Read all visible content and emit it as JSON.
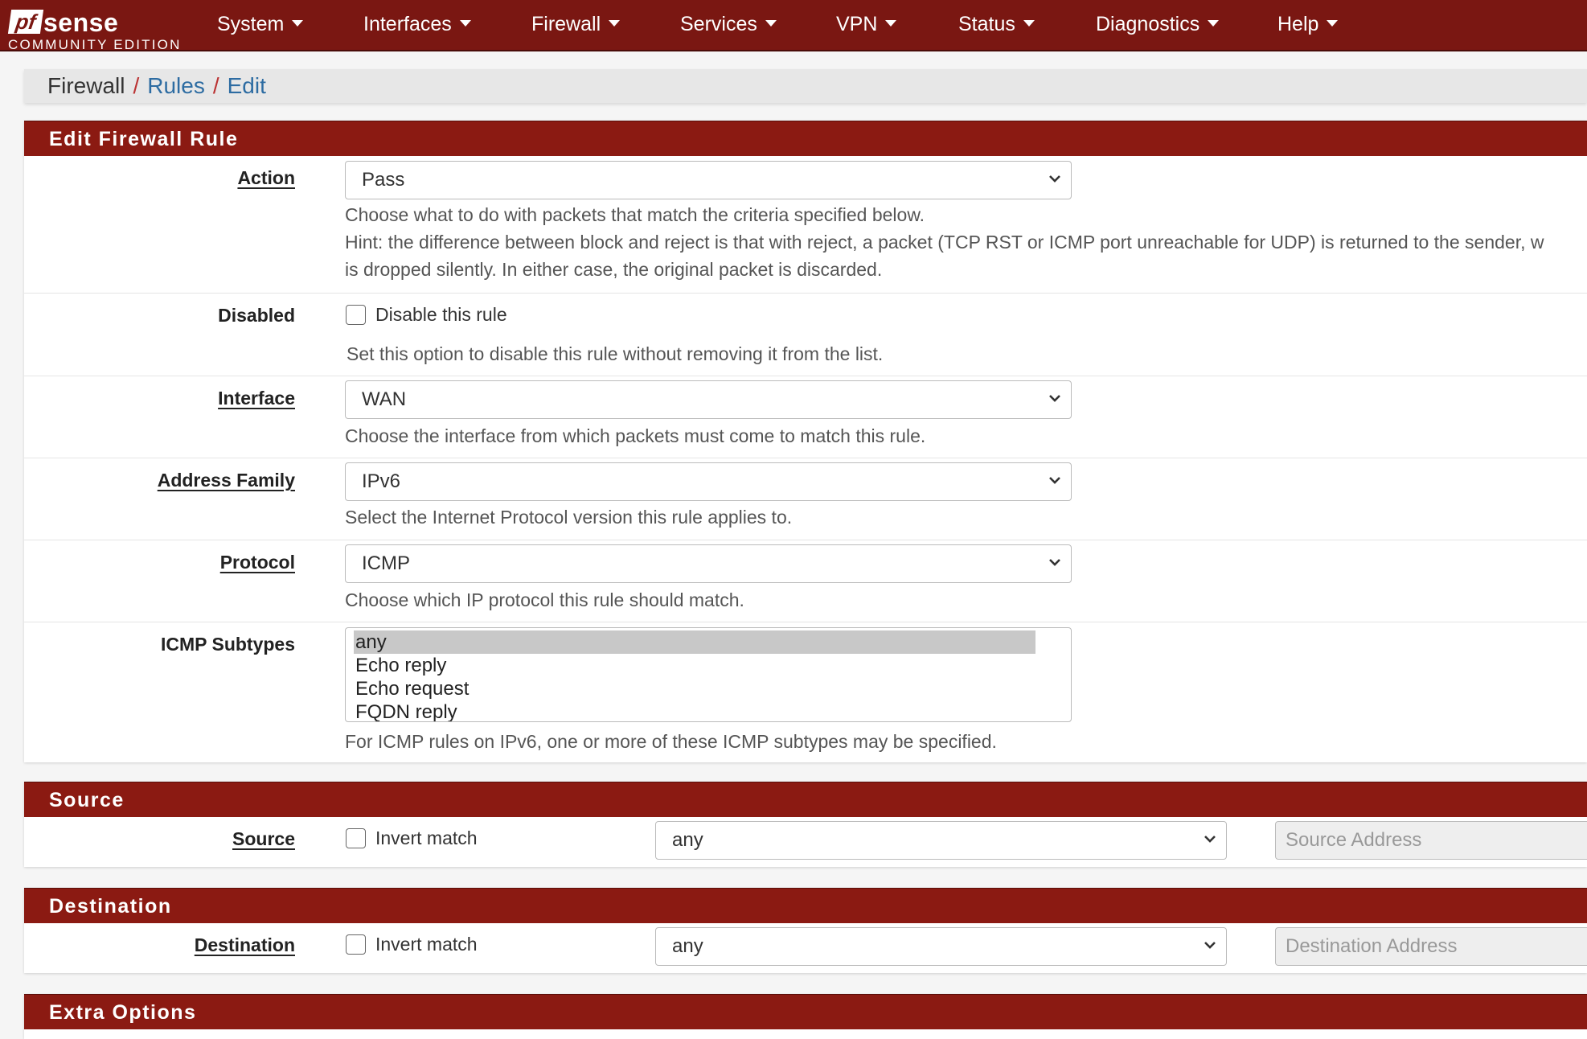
{
  "brand": {
    "logo_pf": "pf",
    "logo_sense": "sense",
    "edition": "COMMUNITY EDITION"
  },
  "nav": [
    {
      "label": "System"
    },
    {
      "label": "Interfaces"
    },
    {
      "label": "Firewall"
    },
    {
      "label": "Services"
    },
    {
      "label": "VPN"
    },
    {
      "label": "Status"
    },
    {
      "label": "Diagnostics"
    },
    {
      "label": "Help"
    }
  ],
  "breadcrumb": {
    "root": "Firewall",
    "rules": "Rules",
    "edit": "Edit",
    "sep": "/"
  },
  "edit_rule": {
    "heading": "Edit Firewall Rule",
    "action": {
      "label": "Action",
      "value": "Pass",
      "help1": "Choose what to do with packets that match the criteria specified below.",
      "help2": "Hint: the difference between block and reject is that with reject, a packet (TCP RST or ICMP port unreachable for UDP) is returned to the sender, w",
      "help3": "is dropped silently. In either case, the original packet is discarded."
    },
    "disabled": {
      "label": "Disabled",
      "checkbox_label": "Disable this rule",
      "help": "Set this option to disable this rule without removing it from the list."
    },
    "interface": {
      "label": "Interface",
      "value": "WAN",
      "help": "Choose the interface from which packets must come to match this rule."
    },
    "address_family": {
      "label": "Address Family",
      "value": "IPv6",
      "help": "Select the Internet Protocol version this rule applies to."
    },
    "protocol": {
      "label": "Protocol",
      "value": "ICMP",
      "help": "Choose which IP protocol this rule should match."
    },
    "icmp_subtypes": {
      "label": "ICMP Subtypes",
      "options": [
        "any",
        "Echo reply",
        "Echo request",
        "FQDN reply"
      ],
      "selected": "any",
      "help": "For ICMP rules on IPv6, one or more of these ICMP subtypes may be specified."
    }
  },
  "source": {
    "heading": "Source",
    "label": "Source",
    "invert_label": "Invert match",
    "value": "any",
    "address_placeholder": "Source Address"
  },
  "destination": {
    "heading": "Destination",
    "label": "Destination",
    "invert_label": "Invert match",
    "value": "any",
    "address_placeholder": "Destination Address"
  },
  "extra": {
    "heading": "Extra Options"
  },
  "colors": {
    "navbar": "#7a1712",
    "panel_heading": "#8b1a12",
    "link": "#2d6ca2"
  }
}
